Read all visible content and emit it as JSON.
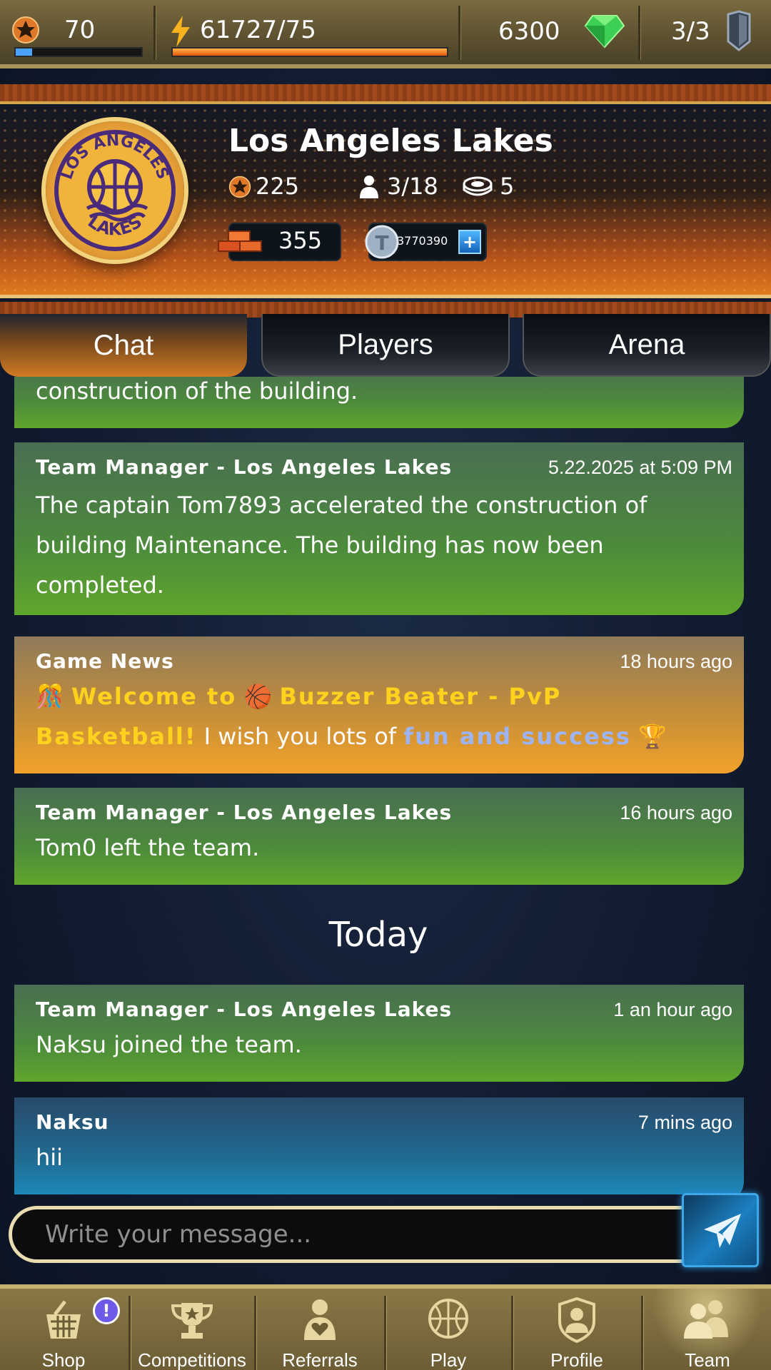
{
  "status_bar": {
    "level": "70",
    "level_progress": 0.13,
    "energy": "61727/75",
    "energy_progress": 1.0,
    "gems": "6300",
    "shields": "3/3"
  },
  "team": {
    "name": "Los Angeles Lakes",
    "logo_text_top": "LOS ANGELES",
    "logo_text_bottom": "LAKES",
    "rating": "225",
    "members": "3/18",
    "arenas": "5",
    "bricks": "355",
    "tokens": "3770390"
  },
  "tabs": [
    {
      "label": "Chat",
      "active": true
    },
    {
      "label": "Players",
      "active": false
    },
    {
      "label": "Arena",
      "active": false
    }
  ],
  "messages": [
    {
      "partial_text": "construction of the building."
    },
    {
      "author": "Team Manager - Los Angeles Lakes",
      "time": "5.22.2025 at 5:09 PM",
      "text": "The captain Tom7893 accelerated the construction of building Maintenance. The building has now been completed."
    },
    {
      "author": "Game News",
      "time": "18  hours ago",
      "welcome": "Welcome to",
      "game_title_line1": "Buzzer Beater - PvP",
      "game_title_line2": "Basketball!",
      "wish": "I wish you lots of",
      "highlight": "fun and success"
    },
    {
      "author": "Team Manager - Los Angeles Lakes",
      "time": "16  hours ago",
      "text": "Tom0 left the team."
    },
    {
      "author": "Team Manager - Los Angeles Lakes",
      "time": "1 an hour ago",
      "text": "Naksu joined the team."
    },
    {
      "author": "Naksu",
      "time": "7  mins ago",
      "text": "hii"
    }
  ],
  "day_separator": "Today",
  "composer": {
    "placeholder": "Write your message..."
  },
  "bottom_nav": [
    {
      "label": "Shop",
      "icon": "basket-icon",
      "badge": "!"
    },
    {
      "label": "Competitions",
      "icon": "trophy-icon"
    },
    {
      "label": "Referrals",
      "icon": "person-heart-icon"
    },
    {
      "label": "Play",
      "icon": "basketball-icon"
    },
    {
      "label": "Profile",
      "icon": "profile-shield-icon"
    },
    {
      "label": "Team",
      "icon": "team-icon",
      "active": true
    }
  ],
  "colors": {
    "accent_orange": "#e07a1e",
    "chat_green": "#5fa62c",
    "news_gold": "#f2a12a",
    "user_blue": "#1a8ec0",
    "highlight_yellow": "#ffd21e"
  }
}
